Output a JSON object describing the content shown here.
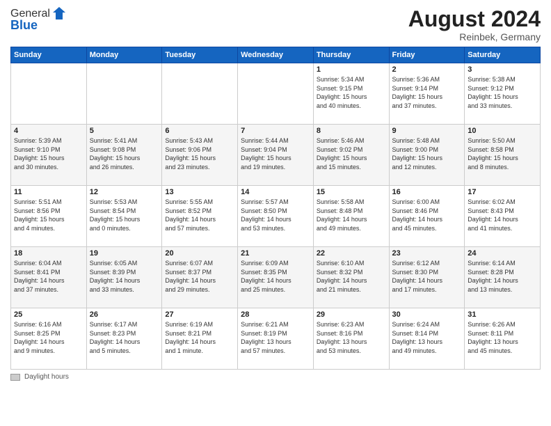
{
  "header": {
    "logo_line1": "General",
    "logo_line2": "Blue",
    "month_year": "August 2024",
    "location": "Reinbek, Germany"
  },
  "footer": {
    "label": "Daylight hours"
  },
  "days_of_week": [
    "Sunday",
    "Monday",
    "Tuesday",
    "Wednesday",
    "Thursday",
    "Friday",
    "Saturday"
  ],
  "weeks": [
    [
      {
        "num": "",
        "info": ""
      },
      {
        "num": "",
        "info": ""
      },
      {
        "num": "",
        "info": ""
      },
      {
        "num": "",
        "info": ""
      },
      {
        "num": "1",
        "info": "Sunrise: 5:34 AM\nSunset: 9:15 PM\nDaylight: 15 hours\nand 40 minutes."
      },
      {
        "num": "2",
        "info": "Sunrise: 5:36 AM\nSunset: 9:14 PM\nDaylight: 15 hours\nand 37 minutes."
      },
      {
        "num": "3",
        "info": "Sunrise: 5:38 AM\nSunset: 9:12 PM\nDaylight: 15 hours\nand 33 minutes."
      }
    ],
    [
      {
        "num": "4",
        "info": "Sunrise: 5:39 AM\nSunset: 9:10 PM\nDaylight: 15 hours\nand 30 minutes."
      },
      {
        "num": "5",
        "info": "Sunrise: 5:41 AM\nSunset: 9:08 PM\nDaylight: 15 hours\nand 26 minutes."
      },
      {
        "num": "6",
        "info": "Sunrise: 5:43 AM\nSunset: 9:06 PM\nDaylight: 15 hours\nand 23 minutes."
      },
      {
        "num": "7",
        "info": "Sunrise: 5:44 AM\nSunset: 9:04 PM\nDaylight: 15 hours\nand 19 minutes."
      },
      {
        "num": "8",
        "info": "Sunrise: 5:46 AM\nSunset: 9:02 PM\nDaylight: 15 hours\nand 15 minutes."
      },
      {
        "num": "9",
        "info": "Sunrise: 5:48 AM\nSunset: 9:00 PM\nDaylight: 15 hours\nand 12 minutes."
      },
      {
        "num": "10",
        "info": "Sunrise: 5:50 AM\nSunset: 8:58 PM\nDaylight: 15 hours\nand 8 minutes."
      }
    ],
    [
      {
        "num": "11",
        "info": "Sunrise: 5:51 AM\nSunset: 8:56 PM\nDaylight: 15 hours\nand 4 minutes."
      },
      {
        "num": "12",
        "info": "Sunrise: 5:53 AM\nSunset: 8:54 PM\nDaylight: 15 hours\nand 0 minutes."
      },
      {
        "num": "13",
        "info": "Sunrise: 5:55 AM\nSunset: 8:52 PM\nDaylight: 14 hours\nand 57 minutes."
      },
      {
        "num": "14",
        "info": "Sunrise: 5:57 AM\nSunset: 8:50 PM\nDaylight: 14 hours\nand 53 minutes."
      },
      {
        "num": "15",
        "info": "Sunrise: 5:58 AM\nSunset: 8:48 PM\nDaylight: 14 hours\nand 49 minutes."
      },
      {
        "num": "16",
        "info": "Sunrise: 6:00 AM\nSunset: 8:46 PM\nDaylight: 14 hours\nand 45 minutes."
      },
      {
        "num": "17",
        "info": "Sunrise: 6:02 AM\nSunset: 8:43 PM\nDaylight: 14 hours\nand 41 minutes."
      }
    ],
    [
      {
        "num": "18",
        "info": "Sunrise: 6:04 AM\nSunset: 8:41 PM\nDaylight: 14 hours\nand 37 minutes."
      },
      {
        "num": "19",
        "info": "Sunrise: 6:05 AM\nSunset: 8:39 PM\nDaylight: 14 hours\nand 33 minutes."
      },
      {
        "num": "20",
        "info": "Sunrise: 6:07 AM\nSunset: 8:37 PM\nDaylight: 14 hours\nand 29 minutes."
      },
      {
        "num": "21",
        "info": "Sunrise: 6:09 AM\nSunset: 8:35 PM\nDaylight: 14 hours\nand 25 minutes."
      },
      {
        "num": "22",
        "info": "Sunrise: 6:10 AM\nSunset: 8:32 PM\nDaylight: 14 hours\nand 21 minutes."
      },
      {
        "num": "23",
        "info": "Sunrise: 6:12 AM\nSunset: 8:30 PM\nDaylight: 14 hours\nand 17 minutes."
      },
      {
        "num": "24",
        "info": "Sunrise: 6:14 AM\nSunset: 8:28 PM\nDaylight: 14 hours\nand 13 minutes."
      }
    ],
    [
      {
        "num": "25",
        "info": "Sunrise: 6:16 AM\nSunset: 8:25 PM\nDaylight: 14 hours\nand 9 minutes."
      },
      {
        "num": "26",
        "info": "Sunrise: 6:17 AM\nSunset: 8:23 PM\nDaylight: 14 hours\nand 5 minutes."
      },
      {
        "num": "27",
        "info": "Sunrise: 6:19 AM\nSunset: 8:21 PM\nDaylight: 14 hours\nand 1 minute."
      },
      {
        "num": "28",
        "info": "Sunrise: 6:21 AM\nSunset: 8:19 PM\nDaylight: 13 hours\nand 57 minutes."
      },
      {
        "num": "29",
        "info": "Sunrise: 6:23 AM\nSunset: 8:16 PM\nDaylight: 13 hours\nand 53 minutes."
      },
      {
        "num": "30",
        "info": "Sunrise: 6:24 AM\nSunset: 8:14 PM\nDaylight: 13 hours\nand 49 minutes."
      },
      {
        "num": "31",
        "info": "Sunrise: 6:26 AM\nSunset: 8:11 PM\nDaylight: 13 hours\nand 45 minutes."
      }
    ]
  ]
}
